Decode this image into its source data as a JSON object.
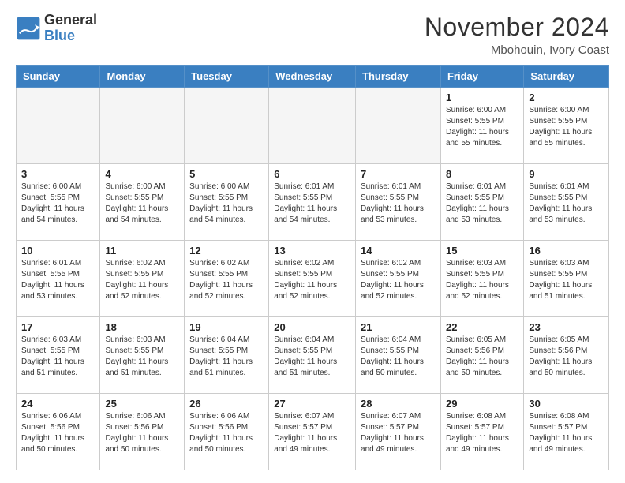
{
  "header": {
    "logo_line1": "General",
    "logo_line2": "Blue",
    "month": "November 2024",
    "location": "Mbohouin, Ivory Coast"
  },
  "weekdays": [
    "Sunday",
    "Monday",
    "Tuesday",
    "Wednesday",
    "Thursday",
    "Friday",
    "Saturday"
  ],
  "weeks": [
    [
      {
        "day": "",
        "info": ""
      },
      {
        "day": "",
        "info": ""
      },
      {
        "day": "",
        "info": ""
      },
      {
        "day": "",
        "info": ""
      },
      {
        "day": "",
        "info": ""
      },
      {
        "day": "1",
        "info": "Sunrise: 6:00 AM\nSunset: 5:55 PM\nDaylight: 11 hours\nand 55 minutes."
      },
      {
        "day": "2",
        "info": "Sunrise: 6:00 AM\nSunset: 5:55 PM\nDaylight: 11 hours\nand 55 minutes."
      }
    ],
    [
      {
        "day": "3",
        "info": "Sunrise: 6:00 AM\nSunset: 5:55 PM\nDaylight: 11 hours\nand 54 minutes."
      },
      {
        "day": "4",
        "info": "Sunrise: 6:00 AM\nSunset: 5:55 PM\nDaylight: 11 hours\nand 54 minutes."
      },
      {
        "day": "5",
        "info": "Sunrise: 6:00 AM\nSunset: 5:55 PM\nDaylight: 11 hours\nand 54 minutes."
      },
      {
        "day": "6",
        "info": "Sunrise: 6:01 AM\nSunset: 5:55 PM\nDaylight: 11 hours\nand 54 minutes."
      },
      {
        "day": "7",
        "info": "Sunrise: 6:01 AM\nSunset: 5:55 PM\nDaylight: 11 hours\nand 53 minutes."
      },
      {
        "day": "8",
        "info": "Sunrise: 6:01 AM\nSunset: 5:55 PM\nDaylight: 11 hours\nand 53 minutes."
      },
      {
        "day": "9",
        "info": "Sunrise: 6:01 AM\nSunset: 5:55 PM\nDaylight: 11 hours\nand 53 minutes."
      }
    ],
    [
      {
        "day": "10",
        "info": "Sunrise: 6:01 AM\nSunset: 5:55 PM\nDaylight: 11 hours\nand 53 minutes."
      },
      {
        "day": "11",
        "info": "Sunrise: 6:02 AM\nSunset: 5:55 PM\nDaylight: 11 hours\nand 52 minutes."
      },
      {
        "day": "12",
        "info": "Sunrise: 6:02 AM\nSunset: 5:55 PM\nDaylight: 11 hours\nand 52 minutes."
      },
      {
        "day": "13",
        "info": "Sunrise: 6:02 AM\nSunset: 5:55 PM\nDaylight: 11 hours\nand 52 minutes."
      },
      {
        "day": "14",
        "info": "Sunrise: 6:02 AM\nSunset: 5:55 PM\nDaylight: 11 hours\nand 52 minutes."
      },
      {
        "day": "15",
        "info": "Sunrise: 6:03 AM\nSunset: 5:55 PM\nDaylight: 11 hours\nand 52 minutes."
      },
      {
        "day": "16",
        "info": "Sunrise: 6:03 AM\nSunset: 5:55 PM\nDaylight: 11 hours\nand 51 minutes."
      }
    ],
    [
      {
        "day": "17",
        "info": "Sunrise: 6:03 AM\nSunset: 5:55 PM\nDaylight: 11 hours\nand 51 minutes."
      },
      {
        "day": "18",
        "info": "Sunrise: 6:03 AM\nSunset: 5:55 PM\nDaylight: 11 hours\nand 51 minutes."
      },
      {
        "day": "19",
        "info": "Sunrise: 6:04 AM\nSunset: 5:55 PM\nDaylight: 11 hours\nand 51 minutes."
      },
      {
        "day": "20",
        "info": "Sunrise: 6:04 AM\nSunset: 5:55 PM\nDaylight: 11 hours\nand 51 minutes."
      },
      {
        "day": "21",
        "info": "Sunrise: 6:04 AM\nSunset: 5:55 PM\nDaylight: 11 hours\nand 50 minutes."
      },
      {
        "day": "22",
        "info": "Sunrise: 6:05 AM\nSunset: 5:56 PM\nDaylight: 11 hours\nand 50 minutes."
      },
      {
        "day": "23",
        "info": "Sunrise: 6:05 AM\nSunset: 5:56 PM\nDaylight: 11 hours\nand 50 minutes."
      }
    ],
    [
      {
        "day": "24",
        "info": "Sunrise: 6:06 AM\nSunset: 5:56 PM\nDaylight: 11 hours\nand 50 minutes."
      },
      {
        "day": "25",
        "info": "Sunrise: 6:06 AM\nSunset: 5:56 PM\nDaylight: 11 hours\nand 50 minutes."
      },
      {
        "day": "26",
        "info": "Sunrise: 6:06 AM\nSunset: 5:56 PM\nDaylight: 11 hours\nand 50 minutes."
      },
      {
        "day": "27",
        "info": "Sunrise: 6:07 AM\nSunset: 5:57 PM\nDaylight: 11 hours\nand 49 minutes."
      },
      {
        "day": "28",
        "info": "Sunrise: 6:07 AM\nSunset: 5:57 PM\nDaylight: 11 hours\nand 49 minutes."
      },
      {
        "day": "29",
        "info": "Sunrise: 6:08 AM\nSunset: 5:57 PM\nDaylight: 11 hours\nand 49 minutes."
      },
      {
        "day": "30",
        "info": "Sunrise: 6:08 AM\nSunset: 5:57 PM\nDaylight: 11 hours\nand 49 minutes."
      }
    ]
  ]
}
